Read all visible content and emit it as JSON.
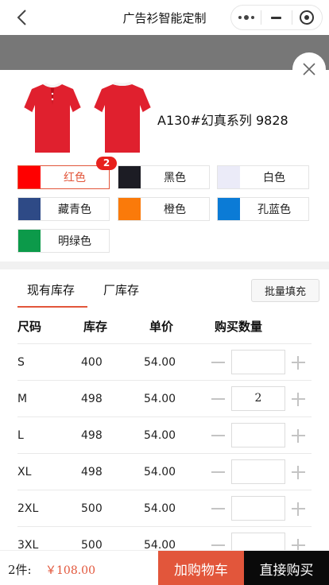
{
  "header": {
    "title": "广告衫智能定制"
  },
  "product": {
    "name": "A130#幻真系列 9828"
  },
  "colors": [
    {
      "label": "红色",
      "hex": "#ff0000",
      "selected": true,
      "count": "2"
    },
    {
      "label": "黑色",
      "hex": "#1c1c24"
    },
    {
      "label": "白色",
      "hex": "#ebebf8"
    },
    {
      "label": "藏青色",
      "hex": "#2e4a86"
    },
    {
      "label": "橙色",
      "hex": "#fa7a0a"
    },
    {
      "label": "孔蓝色",
      "hex": "#0b7bd6"
    },
    {
      "label": "明绿色",
      "hex": "#0c9a4a"
    }
  ],
  "tabs": [
    {
      "label": "现有库存",
      "active": true
    },
    {
      "label": "厂库存"
    }
  ],
  "bulk_fill_label": "批量填充",
  "table": {
    "headers": [
      "尺码",
      "库存",
      "单价",
      "购买数量"
    ],
    "rows": [
      {
        "size": "S",
        "stock": "400",
        "price": "54.00",
        "qty": ""
      },
      {
        "size": "M",
        "stock": "498",
        "price": "54.00",
        "qty": "2"
      },
      {
        "size": "L",
        "stock": "498",
        "price": "54.00",
        "qty": ""
      },
      {
        "size": "XL",
        "stock": "498",
        "price": "54.00",
        "qty": ""
      },
      {
        "size": "2XL",
        "stock": "500",
        "price": "54.00",
        "qty": ""
      },
      {
        "size": "3XL",
        "stock": "500",
        "price": "54.00",
        "qty": ""
      }
    ]
  },
  "footer": {
    "count_label": "2件:",
    "total": "￥108.00",
    "add_cart_label": "加购物车",
    "buy_now_label": "直接购买"
  },
  "theme": {
    "accent": "#e2563b",
    "buy": "#0a0a0a",
    "shirt": "#e0202e"
  }
}
